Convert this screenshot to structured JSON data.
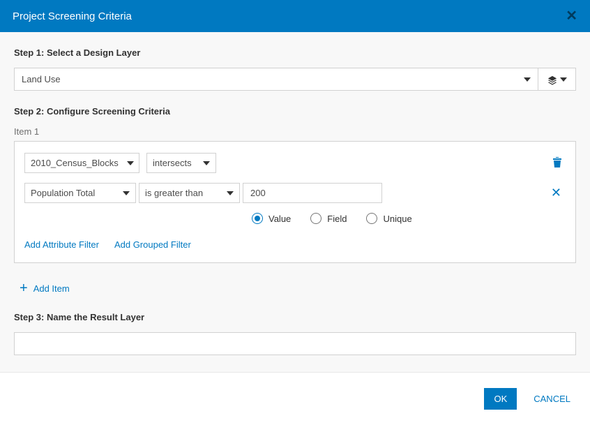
{
  "header": {
    "title": "Project Screening Criteria"
  },
  "step1": {
    "label": "Step 1: Select a Design Layer",
    "design_layer": "Land Use"
  },
  "step2": {
    "label": "Step 2: Configure Screening Criteria",
    "item_label": "Item 1",
    "source_layer": "2010_Census_Blocks",
    "spatial_op": "intersects",
    "field": "Population Total",
    "comparison": "is greater than",
    "value": "200",
    "radios": {
      "value": "Value",
      "field": "Field",
      "unique": "Unique",
      "selected": "value"
    },
    "links": {
      "add_attr": "Add Attribute Filter",
      "add_grouped": "Add Grouped Filter"
    },
    "add_item": "Add Item"
  },
  "step3": {
    "label": "Step 3: Name the Result Layer",
    "value": ""
  },
  "footer": {
    "ok": "OK",
    "cancel": "CANCEL"
  }
}
